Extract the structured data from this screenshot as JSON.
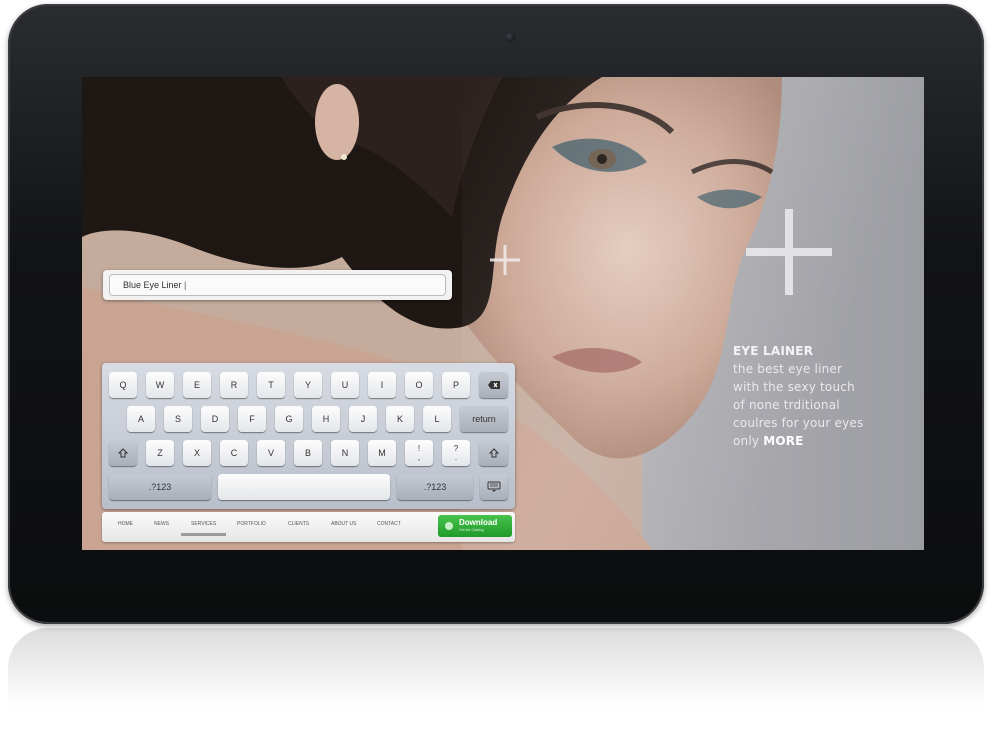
{
  "search": {
    "value": "Blue Eye Liner"
  },
  "keyboard": {
    "row1": [
      "Q",
      "W",
      "E",
      "R",
      "T",
      "Y",
      "U",
      "I",
      "O",
      "P"
    ],
    "row2": [
      "A",
      "S",
      "D",
      "F",
      "G",
      "H",
      "J",
      "K",
      "L"
    ],
    "row3": [
      "Z",
      "X",
      "C",
      "V",
      "B",
      "N",
      "M"
    ],
    "row3_punct": [
      {
        "top": "!",
        "bottom": ","
      },
      {
        "top": "?",
        "bottom": "."
      }
    ],
    "return_label": "return",
    "numbers_left": ".?123",
    "numbers_right": ".?123"
  },
  "nav": {
    "items": [
      "HOME",
      "NEWS",
      "SERVICES",
      "PORTFOLIO",
      "CLIENTS",
      "ABOUT US",
      "CONTACT"
    ],
    "active": "SERVICES",
    "download_label": "Download",
    "download_sub": "Get the Catalog"
  },
  "promo": {
    "title": "EYE LAINER",
    "lines": [
      "the best eye liner",
      "with the sexy touch",
      "of none trditional",
      "coulres for your eyes"
    ],
    "last_line_prefix": "only",
    "more_label": "MORE"
  },
  "icons": {
    "backspace": "backspace-icon",
    "shift": "shift-icon",
    "keyboard_hide": "keyboard-hide-icon",
    "plus": "plus-icon"
  },
  "colors": {
    "download_green": "#2aa836",
    "device_bezel": "#121315",
    "promo_text": "#e9e9ee"
  }
}
